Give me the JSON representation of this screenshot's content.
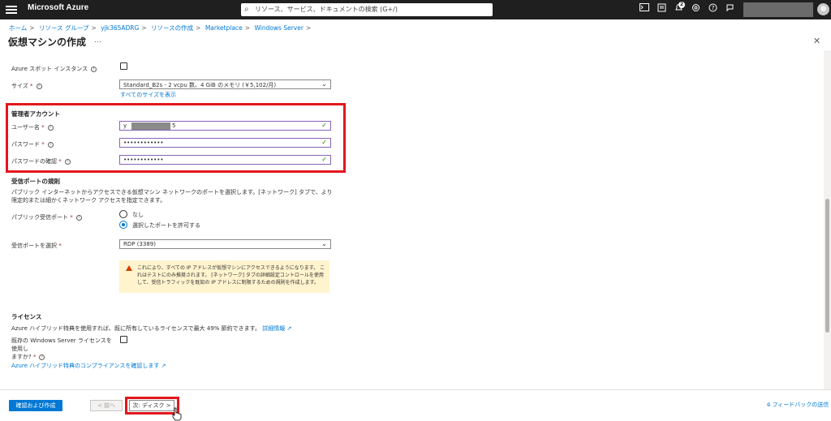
{
  "topbar": {
    "brand": "Microsoft Azure",
    "search_placeholder": "リソース、サービス、ドキュメントの検索 (G+/)",
    "notification_count": "2",
    "icons": [
      "cloud-shell-icon",
      "directory-filter-icon",
      "notifications-icon",
      "settings-icon",
      "help-icon",
      "feedback-icon"
    ]
  },
  "breadcrumb": [
    "ホーム",
    "リソース グループ",
    "yjk365ADRG",
    "リソースの作成",
    "Marketplace",
    "Windows Server"
  ],
  "page": {
    "title": "仮想マシンの作成",
    "more": "…",
    "close": "✕"
  },
  "form": {
    "spot_label": "Azure スポット インスタンス",
    "size_label": "サイズ",
    "size_value": "Standard_B2s - 2 vcpu 数、4 GiB のメモリ (￥5,102/月)",
    "size_link": "すべてのサイズを表示",
    "admin_section": "管理者アカウント",
    "username_label": "ユーザー名",
    "username_prefix": "y",
    "username_suffix": "5",
    "password_label": "パスワード",
    "password_value": "••••••••••••",
    "confirm_label": "パスワードの確認",
    "confirm_value": "••••••••••••",
    "inbound_section": "受信ポートの規則",
    "inbound_desc": "パブリック インターネットからアクセスできる仮想マシン ネットワークのポートを選択します。[ネットワーク] タブで、より限定的または細かくネットワーク アクセスを指定できます。",
    "public_ports_label": "パブリック受信ポート",
    "radio_none": "なし",
    "radio_allow": "選択したポートを許可する",
    "select_ports_label": "受信ポートを選択",
    "select_ports_value": "RDP (3389)",
    "warning_text": "これにより、すべての IP アドレスが仮想マシンにアクセスできるようになります。 これはテストにのみ推奨されます。 [ネットワーク] タブの詳細設定コントロールを使用して、受信トラフィックを既知の IP アドレスに制限するための規則を作成します。",
    "license_section": "ライセンス",
    "license_desc": "Azure ハイブリッド特典を使用すれば、既に所有しているライセンスで最大 49% 節約できます。",
    "license_more_link": "詳細情報",
    "license_checkbox_label_1": "既存の Windows Server ライセンスを使用し",
    "license_checkbox_label_2": "ますか?",
    "compliance_link": "Azure ハイブリッド特典のコンプライアンスを確認します"
  },
  "footer": {
    "review_create": "確認および作成",
    "prev": "< 前へ",
    "next": "次: ディスク >",
    "feedback": "フィードバックの送信"
  }
}
